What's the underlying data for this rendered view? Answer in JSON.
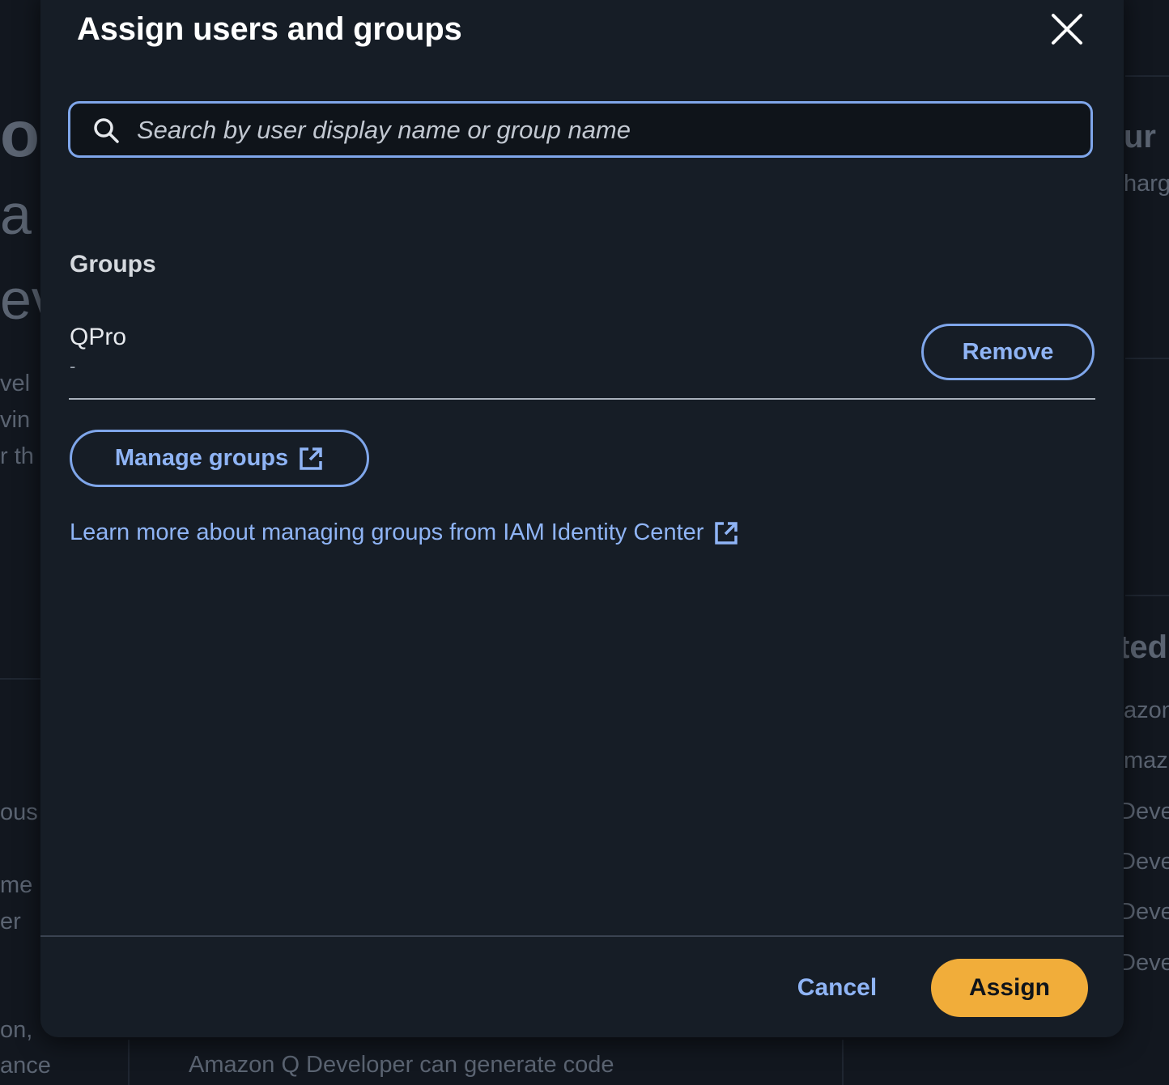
{
  "modal": {
    "title": "Assign users and groups",
    "close_icon": "close-icon",
    "search": {
      "placeholder": "Search by user display name or group name",
      "value": "",
      "icon": "search-icon"
    },
    "groups_heading": "Groups",
    "groups": [
      {
        "name": "QPro",
        "description": "-",
        "action_label": "Remove"
      }
    ],
    "manage_groups_label": "Manage groups",
    "learn_more_label": "Learn more about managing groups from IAM Identity Center",
    "external_link_icon": "external-link-icon",
    "cancel_label": "Cancel",
    "assign_label": "Assign"
  },
  "background_fragments": {
    "left": [
      "o",
      "a",
      "ev",
      "vel",
      "vin",
      "r th",
      "ous",
      "me",
      "er",
      "on,",
      "ance"
    ],
    "right": [
      "ur",
      "harg",
      "ted",
      "azon",
      "maz",
      "Deve",
      "Deve",
      "Deve",
      "Deve"
    ],
    "bottom": "Amazon Q Developer can generate code"
  },
  "colors": {
    "page_bg": "#12171f",
    "modal_bg": "#161d26",
    "link": "#8fb4f5",
    "border_focus": "#7fa6ea",
    "primary_button": "#f1ad3a"
  }
}
